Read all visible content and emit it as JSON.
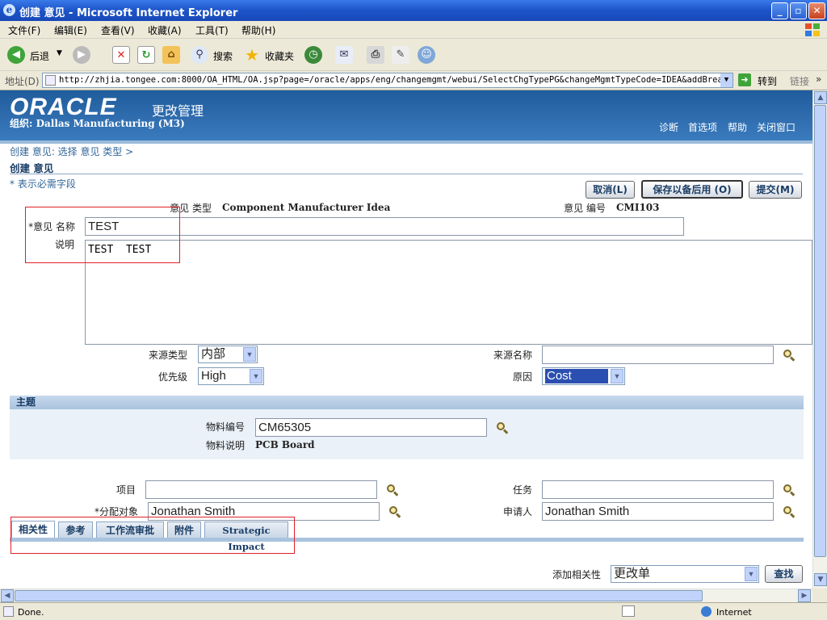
{
  "window": {
    "title": "创建 意见 - Microsoft Internet Explorer",
    "minimize": "_",
    "maximize": "▫",
    "close": "✕"
  },
  "menu": [
    "文件(F)",
    "编辑(E)",
    "查看(V)",
    "收藏(A)",
    "工具(T)",
    "帮助(H)"
  ],
  "toolbar": {
    "back": "后退",
    "search": "搜索",
    "favorites": "收藏夹"
  },
  "address": {
    "label": "地址(D)",
    "url": "http://zhjia.tongee.com:8000/OA_HTML/OA.jsp?page=/oracle/apps/eng/changemgmt/webui/SelectChgTypePG&changeMgmtTypeCode=IDEA&addBreadCrumb",
    "go": "转到",
    "links": "链接"
  },
  "header": {
    "logo": "ORACLE",
    "app": "更改管理",
    "org": "组织: Dallas Manufacturing (M3)",
    "links": [
      "诊断",
      "首选项",
      "帮助",
      "关闭窗口"
    ]
  },
  "breadcrumb": "创建 意见: 选择 意见 类型 >",
  "page_title": "创建 意见",
  "required_hint": "* 表示必需字段",
  "buttons": {
    "cancel": "取消(L)",
    "save_later": "保存以备后用 (O)",
    "submit": "提交(M)",
    "search": "查找"
  },
  "form": {
    "type_label": "意见 类型",
    "type_value": "Component Manufacturer Idea",
    "number_label": "意见 编号",
    "number_value": "CMI103",
    "name_label": "*意见 名称",
    "name_value": "TEST",
    "desc_label": "说明",
    "desc_value": "TEST  TEST",
    "source_type_label": "来源类型",
    "source_type_value": "内部",
    "source_name_label": "来源名称",
    "source_name_value": "",
    "priority_label": "优先级",
    "priority_value": "High",
    "reason_label": "原因",
    "reason_value": "Cost",
    "project_label": "项目",
    "project_value": "",
    "task_label": "任务",
    "task_value": "",
    "assignee_label": "*分配对象",
    "assignee_value": "Jonathan Smith",
    "requester_label": "申请人",
    "requester_value": "Jonathan Smith"
  },
  "subject": {
    "title": "主题",
    "item_no_label": "物料编号",
    "item_no_value": "CM65305",
    "item_desc_label": "物料说明",
    "item_desc_value": "PCB Board"
  },
  "tabs": [
    "相关性",
    "参考",
    "工作流审批",
    "附件",
    "Strategic Impact"
  ],
  "add_relation": {
    "label": "添加相关性",
    "value": "更改单"
  },
  "status": {
    "text": "Done.",
    "zone": "Internet"
  }
}
